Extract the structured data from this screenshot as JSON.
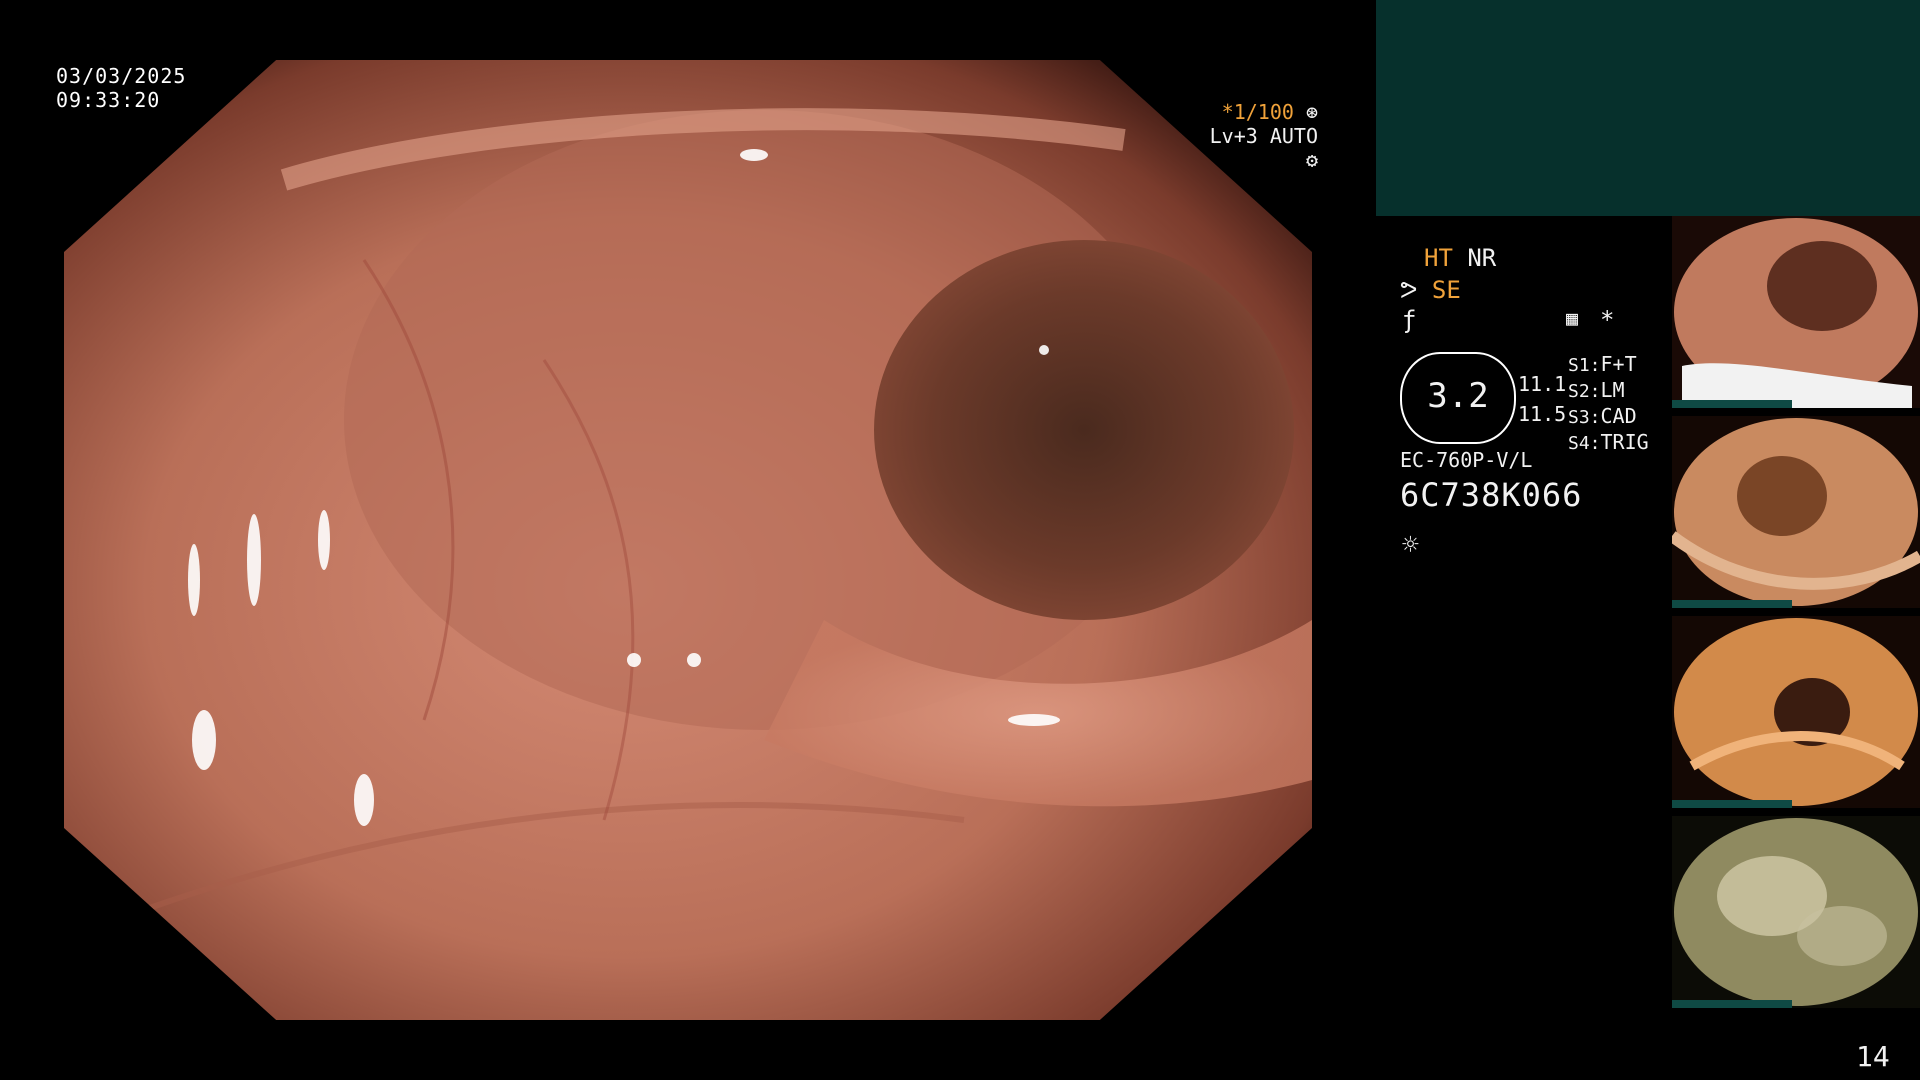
{
  "overlay": {
    "date": "03/03/2025",
    "time": "09:33:20",
    "shutter": "*1/100",
    "level": "Lv+3 AUTO",
    "mode_ht": "HT",
    "mode_nr": "NR",
    "mode_se": "SE",
    "zoom_value": "3.2",
    "side_val_1": "11.1",
    "side_val_2": "11.5",
    "star": "*",
    "s_keys": [
      "S1:",
      "S2:",
      "S3:",
      "S4:"
    ],
    "s_vals": [
      "F+T",
      "LM",
      "CAD",
      "TRIG"
    ],
    "model": "EC-760P-V/L",
    "serial": "6C738K066",
    "page_number": "14"
  },
  "colors": {
    "accent": "#f0a23a",
    "panel": "#06302c",
    "mucosa": "#c97a62"
  },
  "icons": [
    "aperture-icon",
    "gear-icon",
    "wave-icon",
    "grid-icon",
    "sun-icon"
  ]
}
